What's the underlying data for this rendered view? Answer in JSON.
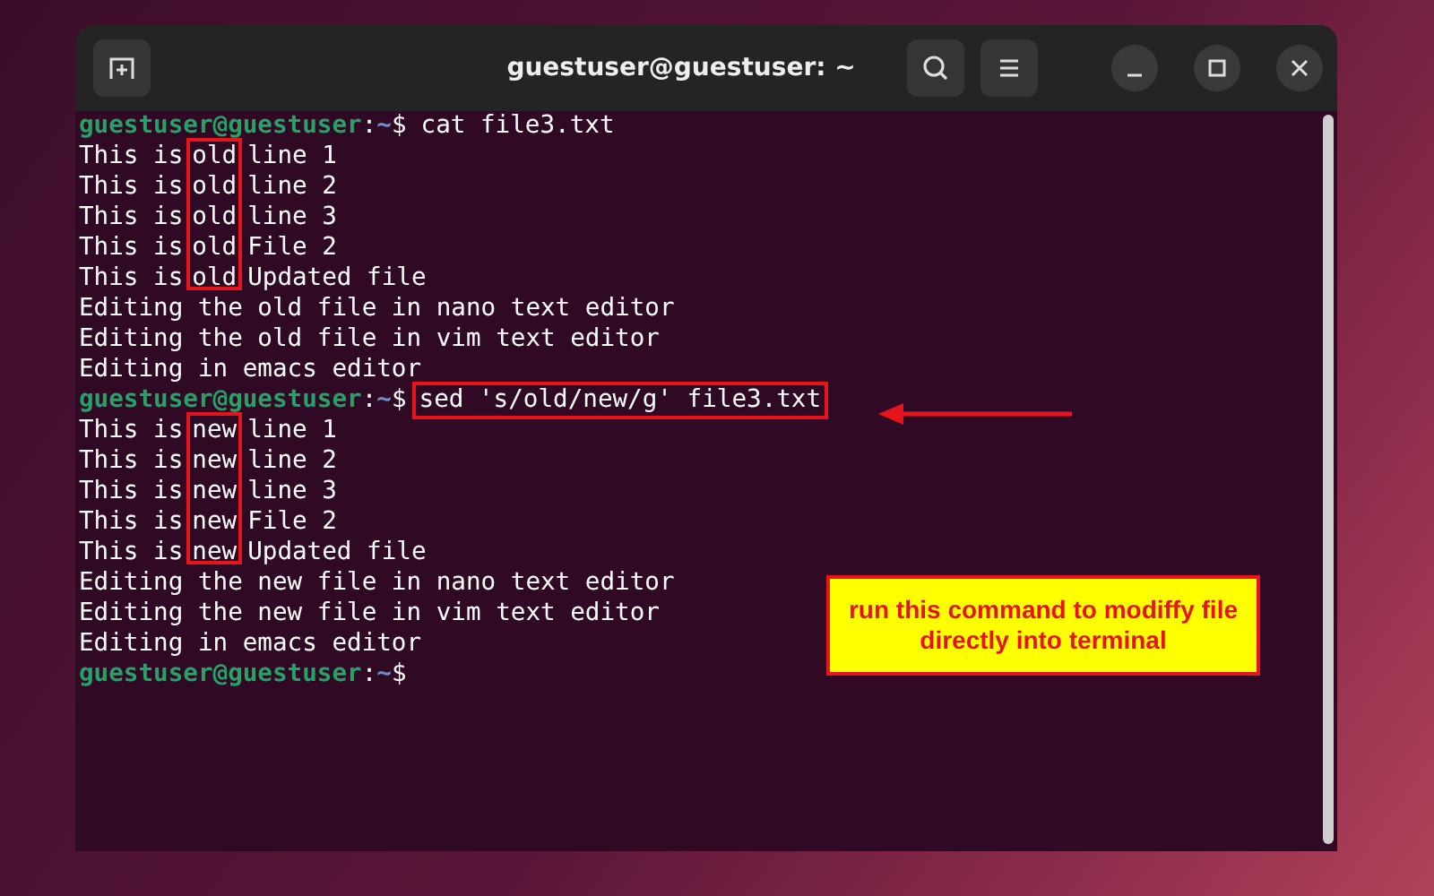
{
  "window": {
    "title": "guestuser@guestuser: ~"
  },
  "terminal": {
    "blocks": [
      {
        "kind": "prompt",
        "user": "guestuser@guestuser",
        "separator": ":",
        "path": "~",
        "symbol": "$",
        "command": "cat file3.txt"
      },
      {
        "kind": "boxed_block",
        "rows": [
          {
            "before": "This is",
            "boxed": "old",
            "after": "line 1"
          },
          {
            "before": "This is",
            "boxed": "old",
            "after": "line 2"
          },
          {
            "before": "This is",
            "boxed": "old",
            "after": "line 3"
          },
          {
            "before": "This is",
            "boxed": "old",
            "after": "File 2"
          },
          {
            "before": "This is",
            "boxed": "old",
            "after": "Updated file"
          }
        ]
      },
      {
        "kind": "text",
        "lines": [
          "Editing the old file in nano text editor",
          "Editing the old file in vim text editor",
          "Editing in emacs editor"
        ]
      },
      {
        "kind": "prompt",
        "user": "guestuser@guestuser",
        "separator": ":",
        "path": "~",
        "symbol": "$",
        "command": "sed 's/old/new/g' file3.txt",
        "boxed": true
      },
      {
        "kind": "boxed_block",
        "rows": [
          {
            "before": "This is",
            "boxed": "new",
            "after": "line 1"
          },
          {
            "before": "This is",
            "boxed": "new",
            "after": "line 2"
          },
          {
            "before": "This is",
            "boxed": "new",
            "after": "line 3"
          },
          {
            "before": "This is",
            "boxed": "new",
            "after": "File 2"
          },
          {
            "before": "This is",
            "boxed": "new",
            "after": "Updated file"
          }
        ]
      },
      {
        "kind": "text",
        "lines": [
          "Editing the new file in nano text editor",
          "Editing the new file in vim text editor",
          "Editing in emacs editor"
        ]
      },
      {
        "kind": "prompt",
        "user": "guestuser@guestuser",
        "separator": ":",
        "path": "~",
        "symbol": "$"
      }
    ]
  },
  "callout": {
    "text": "run this command to modiffy file directly into terminal"
  }
}
